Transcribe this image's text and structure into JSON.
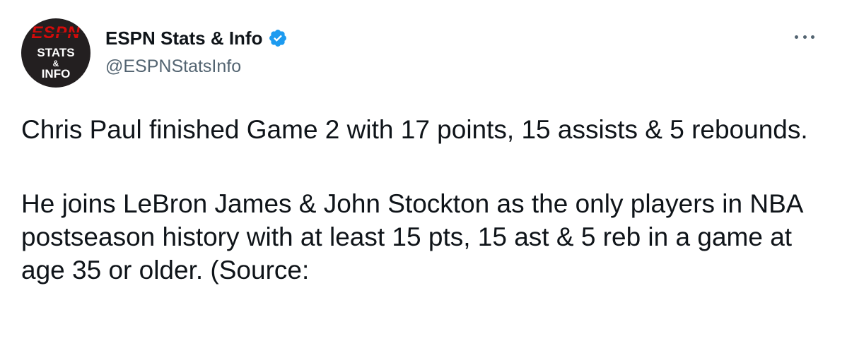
{
  "account": {
    "display_name": "ESPN Stats & Info",
    "handle": "@ESPNStatsInfo",
    "verified": true,
    "avatar": {
      "logo_text": "ESPN",
      "line1": "STATS",
      "line2": "&",
      "line3": "INFO"
    }
  },
  "menu": {
    "icon": "more-horizontal-icon"
  },
  "tweet": {
    "paragraphs": [
      "Chris Paul finished Game 2 with 17 points, 15 assists & 5 rebounds.",
      "He joins LeBron James & John Stockton as the only players in NBA postseason history with at least 15 pts, 15 ast & 5 reb in a game at age 35 or older.  (Source:"
    ]
  },
  "colors": {
    "text": "#0f1419",
    "secondary": "#536471",
    "verified": "#1d9bf0",
    "espn_red": "#d50a0a",
    "avatar_bg": "#231f20"
  }
}
